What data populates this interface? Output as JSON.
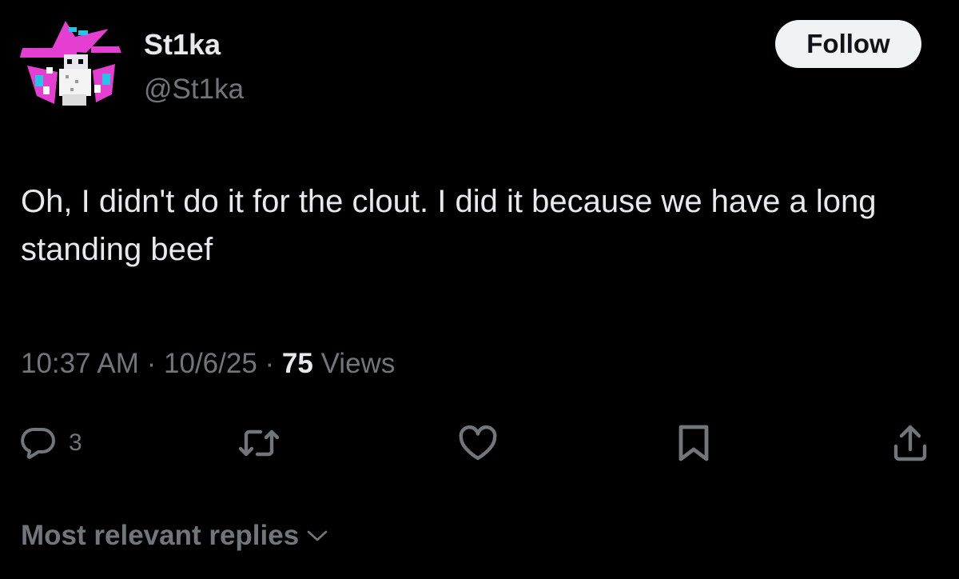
{
  "author": {
    "display_name": "St1ka",
    "handle": "@St1ka",
    "avatar_icon": "pixel-wizard-avatar"
  },
  "follow_button": {
    "label": "Follow"
  },
  "tweet": {
    "text": "Oh, I didn't do it for the clout. I did it because we have a long standing beef"
  },
  "meta": {
    "time": "10:37 AM",
    "separator": "·",
    "date": "10/6/25",
    "views_count": "75",
    "views_label": "Views"
  },
  "actions": {
    "reply": {
      "icon": "reply-bubble-icon",
      "count": "3"
    },
    "repost": {
      "icon": "repost-icon"
    },
    "like": {
      "icon": "heart-icon"
    },
    "bookmark": {
      "icon": "bookmark-icon"
    },
    "share": {
      "icon": "share-icon"
    }
  },
  "replies_sort": {
    "label": "Most relevant replies",
    "icon": "chevron-down-icon"
  },
  "colors": {
    "background": "#000000",
    "primary_text": "#e7e9ea",
    "secondary_text": "#71767b",
    "follow_bg": "#eff3f4",
    "avatar_pink": "#e43fd0",
    "avatar_cyan": "#27c4ea"
  }
}
